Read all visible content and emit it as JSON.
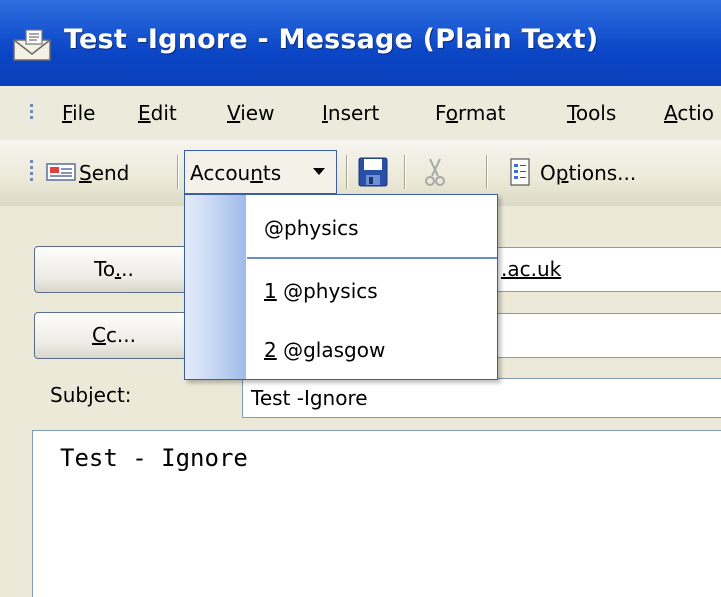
{
  "window": {
    "title": "Test -Ignore - Message (Plain Text)"
  },
  "menu": {
    "items": [
      {
        "label": "File",
        "accel": "F",
        "rest": "ile"
      },
      {
        "label": "Edit",
        "accel": "E",
        "rest": "dit"
      },
      {
        "label": "View",
        "accel": "V",
        "rest": "iew"
      },
      {
        "label": "Insert",
        "accel": "I",
        "rest": "nsert"
      },
      {
        "label": "Format",
        "pre": "F",
        "accel": "o",
        "rest": "rmat"
      },
      {
        "label": "Tools",
        "accel": "T",
        "rest": "ools"
      },
      {
        "label": "Actio",
        "accel": "A",
        "rest": "ctio"
      }
    ]
  },
  "toolbar": {
    "send_accel": "S",
    "send_rest": "end",
    "accounts_pre": "Accou",
    "accounts_accel": "n",
    "accounts_rest": "ts",
    "options_pre": "O",
    "options_accel": "p",
    "options_rest": "tions..."
  },
  "accounts_menu": {
    "header": "@physics",
    "items": [
      {
        "accel": "1",
        "text": " @physics"
      },
      {
        "accel": "2",
        "text": " @glasgow"
      }
    ]
  },
  "address": {
    "to_button_pre": "To",
    "to_button_accel": ".",
    "to_button_rest": "..",
    "to_value": ".ac.uk",
    "cc_button_accel": "C",
    "cc_button_rest": "c...",
    "cc_value": ""
  },
  "subject": {
    "label_pre": "Sub",
    "label_accel": "j",
    "label_rest": "ect:",
    "value": "Test -Ignore"
  },
  "message": {
    "body": "Test - Ignore"
  }
}
